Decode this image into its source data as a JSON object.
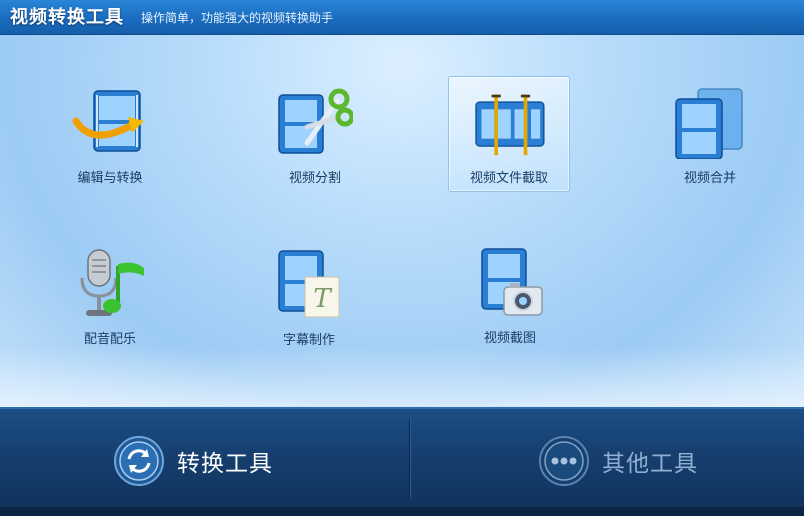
{
  "header": {
    "title": "视频转换工具",
    "subtitle": "操作简单，功能强大的视频转换助手"
  },
  "tools": [
    {
      "label": "编辑与转换",
      "icon": "film-arrow-icon"
    },
    {
      "label": "视频分割",
      "icon": "film-scissors-icon"
    },
    {
      "label": "视频文件截取",
      "icon": "film-clip-icon",
      "selected": true
    },
    {
      "label": "视频合并",
      "icon": "film-merge-icon"
    },
    {
      "label": "配音配乐",
      "icon": "microphone-music-icon"
    },
    {
      "label": "字幕制作",
      "icon": "film-subtitle-icon"
    },
    {
      "label": "视频截图",
      "icon": "film-camera-icon"
    }
  ],
  "bottom": {
    "convert_label": "转换工具",
    "other_label": "其他工具"
  },
  "status": {
    "text": ""
  },
  "colors": {
    "header": "#1a6cc0",
    "film_blue": "#2a7fd4",
    "bottom_bar": "#163f6f",
    "label_text": "#1b3e66"
  }
}
